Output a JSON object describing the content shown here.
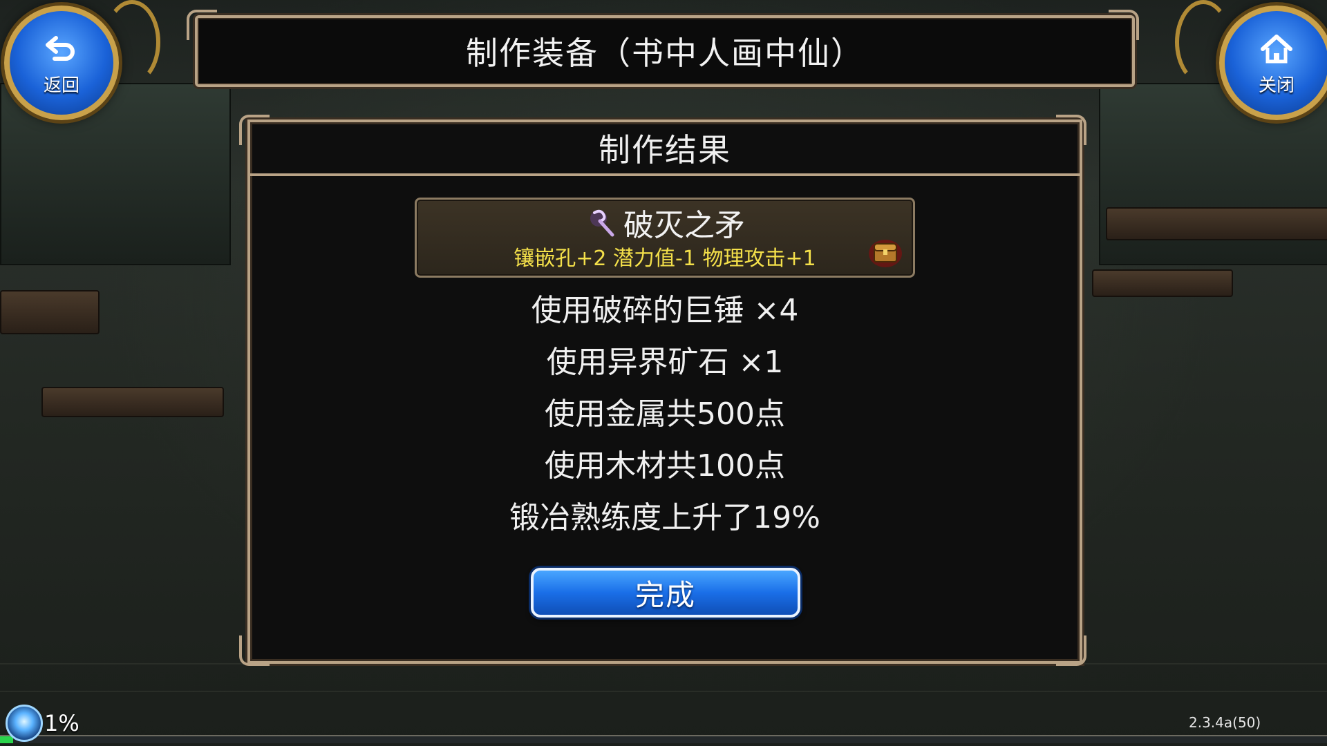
{
  "header": {
    "title": "制作装备（书中人画中仙）",
    "back_label": "返回",
    "close_label": "关闭"
  },
  "panel": {
    "title": "制作结果"
  },
  "item": {
    "name": "破灭之矛",
    "stats": "镶嵌孔+2 潜力值-1 物理攻击+1",
    "name_icon": "staff-icon",
    "corner_icon": "treasure-chest-icon"
  },
  "results": [
    "使用破碎的巨锤 ×4",
    "使用异界矿石 ×1",
    "使用金属共500点",
    "使用木材共100点",
    "锻冶熟练度上升了19%"
  ],
  "done_button": {
    "label": "完成"
  },
  "hud": {
    "progress_percent": "1%",
    "progress_value": 0.01,
    "version": "2.3.4a(50)"
  },
  "colors": {
    "frame": "#b9a386",
    "stats_text": "#f4e04a",
    "button_blue": "#1a6fe8",
    "progress": "#2bd44c"
  }
}
